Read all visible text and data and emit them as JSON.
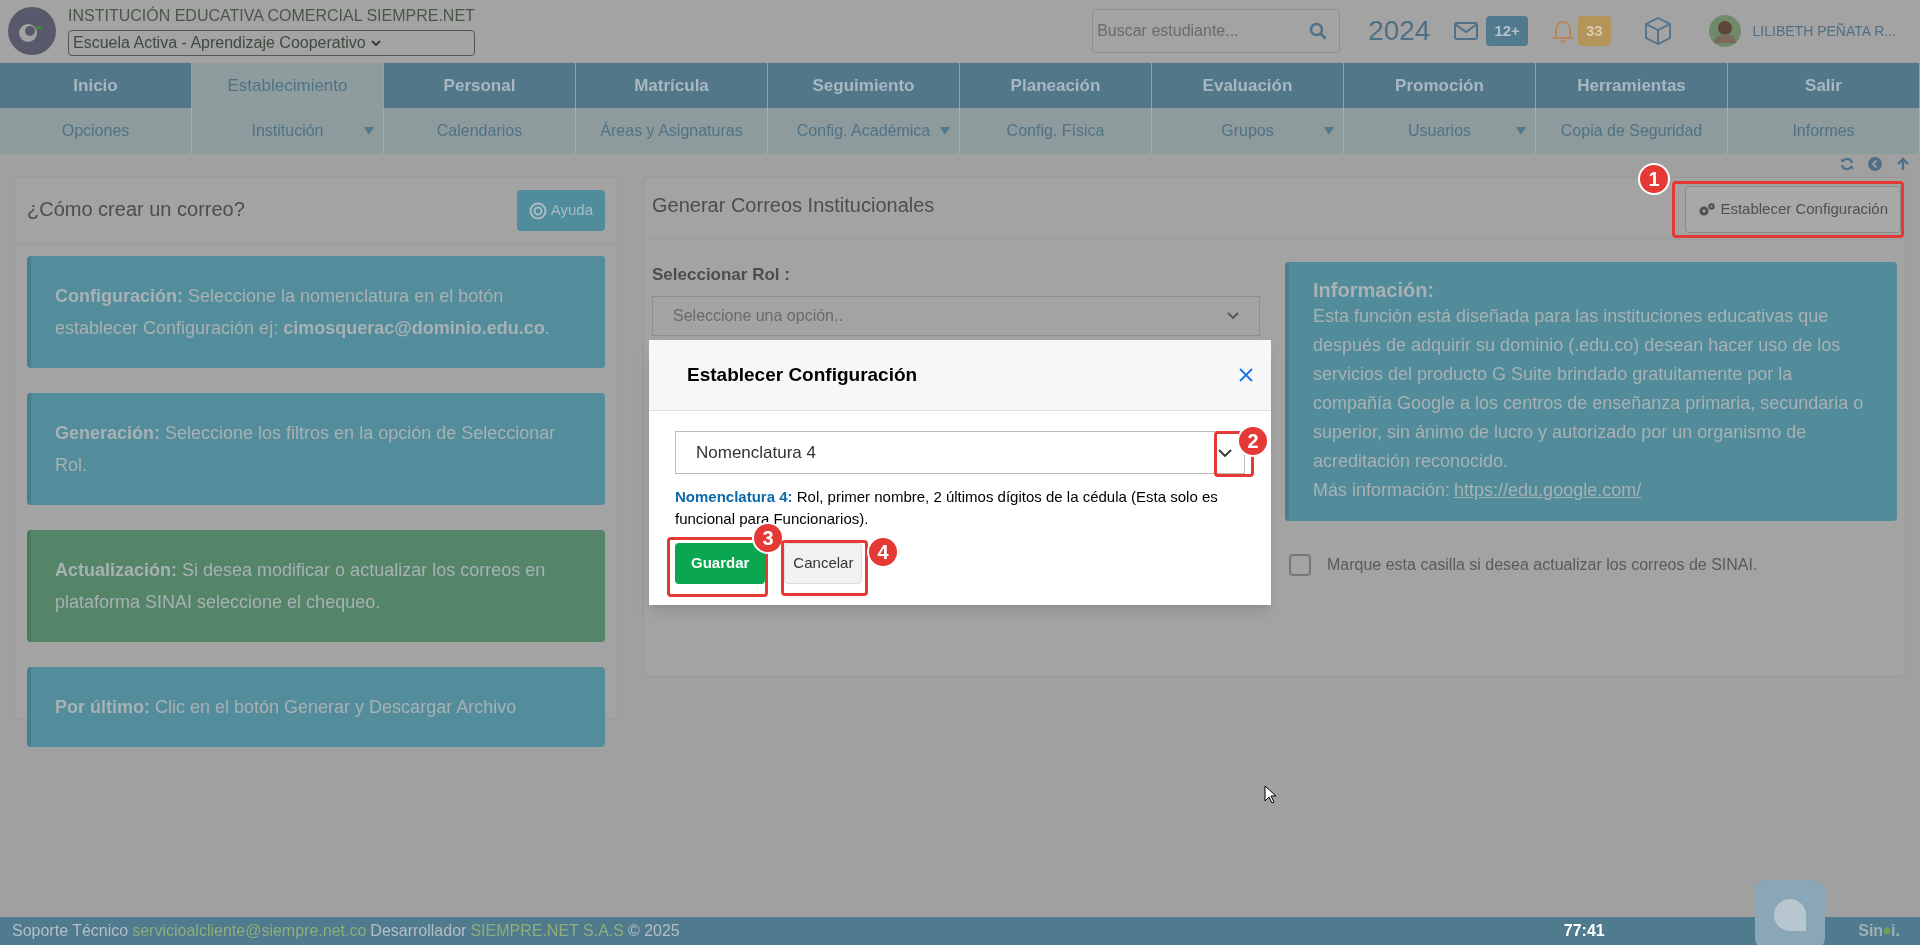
{
  "header": {
    "institution": "INSTITUCIÓN EDUCATIVA COMERCIAL SIEMPRE.NET",
    "model_select": "Escuela Activa - Aprendizaje Cooperativo",
    "search_placeholder": "Buscar estudiante...",
    "year": "2024",
    "messages_badge": "12+",
    "notifications_badge": "33",
    "user_name": "LILIBETH PEÑATA R..."
  },
  "main_menu": [
    {
      "label": "Inicio",
      "selected": false
    },
    {
      "label": "Establecimiento",
      "selected": true
    },
    {
      "label": "Personal",
      "selected": false
    },
    {
      "label": "Matrícula",
      "selected": false
    },
    {
      "label": "Seguimiento",
      "selected": false
    },
    {
      "label": "Planeación",
      "selected": false
    },
    {
      "label": "Evaluación",
      "selected": false
    },
    {
      "label": "Promoción",
      "selected": false
    },
    {
      "label": "Herramientas",
      "selected": false
    },
    {
      "label": "Salir",
      "selected": false
    }
  ],
  "sub_menu": [
    {
      "label": "Opciones",
      "has_dropdown": false
    },
    {
      "label": "Institución",
      "has_dropdown": true
    },
    {
      "label": "Calendarios",
      "has_dropdown": false
    },
    {
      "label": "Áreas y Asignaturas",
      "has_dropdown": false
    },
    {
      "label": "Config. Académica",
      "has_dropdown": true
    },
    {
      "label": "Config. Física",
      "has_dropdown": false
    },
    {
      "label": "Grupos",
      "has_dropdown": true
    },
    {
      "label": "Usuarios",
      "has_dropdown": true
    },
    {
      "label": "Copia de Seguridad",
      "has_dropdown": false
    },
    {
      "label": "Informes",
      "has_dropdown": false
    }
  ],
  "help_panel": {
    "title": "¿Cómo crear un correo?",
    "help_button": "Ayuda",
    "steps": [
      {
        "kind": "info",
        "text": "**Configuración:** Seleccione la nomenclatura en el botón establecer Configuración ej: **cimosquerac@dominio.edu.co**."
      },
      {
        "kind": "info",
        "text": "**Generación:** Seleccione los filtros en la opción de Seleccionar Rol."
      },
      {
        "kind": "success",
        "text": "**Actualización:** Si desea modificar o actualizar los correos en plataforma SINAI seleccione el chequeo."
      },
      {
        "kind": "info",
        "text": "**Por último:** Clic en el botón Generar y Descargar Archivo"
      }
    ]
  },
  "generate_panel": {
    "title": "Generar Correos Institucionales",
    "config_button": "Establecer Configuración",
    "role_label": "Seleccionar Rol :",
    "role_placeholder": "Seleccione una opción..",
    "info_title": "Información:",
    "info_text": "Esta función está diseñada para las instituciones educativas que después de adquirir su dominio (.edu.co) desean hacer uso de los servicios del producto G Suite brindado gratuitamente por la compañía Google a los centros de enseñanza primaria, secundaria o superior, sin ánimo de lucro y autorizado por un organismo de acreditación reconocido.",
    "more_info_label": "Más información:",
    "more_info_link": "https://edu.google.com/",
    "update_checkbox": {
      "label": "Marque esta casilla si desea actualizar los correos de SINAI.",
      "checked": false
    }
  },
  "modal": {
    "title": "Establecer Configuración",
    "select_value": "Nomenclatura 4",
    "description_label": "Nomenclatura 4:",
    "description_text": "Rol, primer nombre, 2 últimos dígitos de la cédula (Esta solo es funcional para Funcionarios).",
    "save_button": "Guardar",
    "cancel_button": "Cancelar"
  },
  "annotations": [
    {
      "number": "1"
    },
    {
      "number": "2"
    },
    {
      "number": "3"
    },
    {
      "number": "4"
    }
  ],
  "footer": {
    "support_label": "Soporte Técnico",
    "support_email": "servicioalcliente@siempre.net.co",
    "developer_label": "Desarrollador",
    "developer_name": "SIEMPRE.NET S.A.S",
    "copyright": "© 2025",
    "timer": "77:41",
    "logo_start": "Sin",
    "logo_end": "i."
  }
}
